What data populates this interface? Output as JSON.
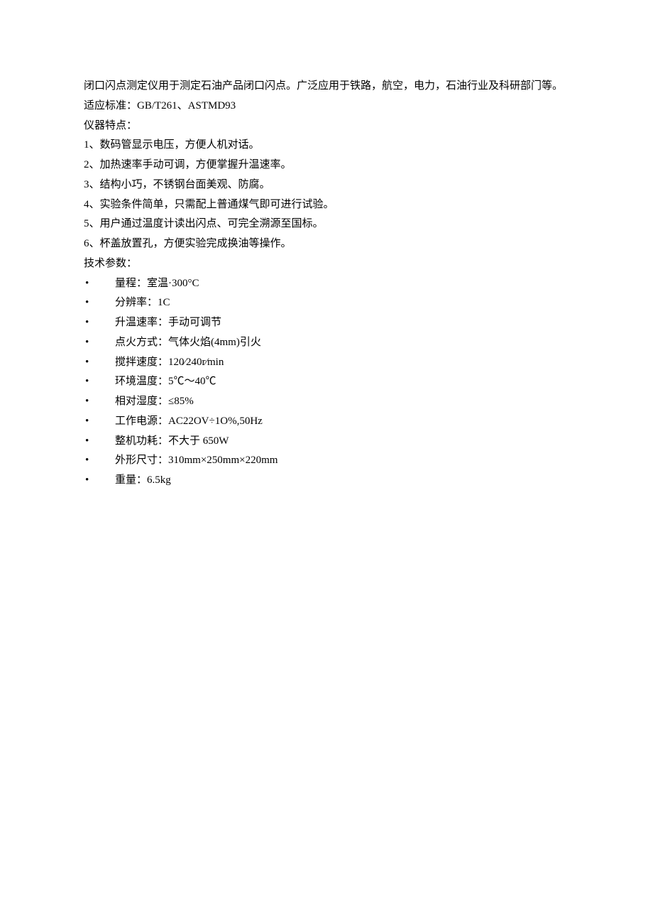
{
  "intro": "闭口闪点测定仪用于测定石油产品闭口闪点。广泛应用于铁路，航空，电力，石油行业及科研部门等。",
  "standard_line": "适应标准：GB/T261、ASTMD93",
  "features_title": "仪器特点：",
  "features": [
    "1、数码管显示电压，方便人机对话。",
    "2、加热速率手动可调，方便掌握升温速率。",
    "3、结构小巧，不锈钢台面美观、防腐。",
    "4、实验条件简单，只需配上普通煤气即可进行试验。",
    "5、用户通过温度计读出闪点、可完全溯源至国标。",
    "6、杯盖放置孔，方便实验完成换油等操作。"
  ],
  "specs_title": "技术参数：",
  "specs": [
    "量程：室温·300°C",
    "分辨率：1C",
    "升温速率：手动可调节",
    "点火方式：气体火焰(4mm)引火",
    "搅拌速度：120⁄240r⁄min",
    "环境温度：5℃～40℃",
    "相对湿度：≤85%",
    "工作电源：AC22OV÷1O%,50Hz",
    "整机功耗：不大于 650W",
    "外形尺寸：310mm×250mm×220mm",
    "重量：6.5kg"
  ]
}
